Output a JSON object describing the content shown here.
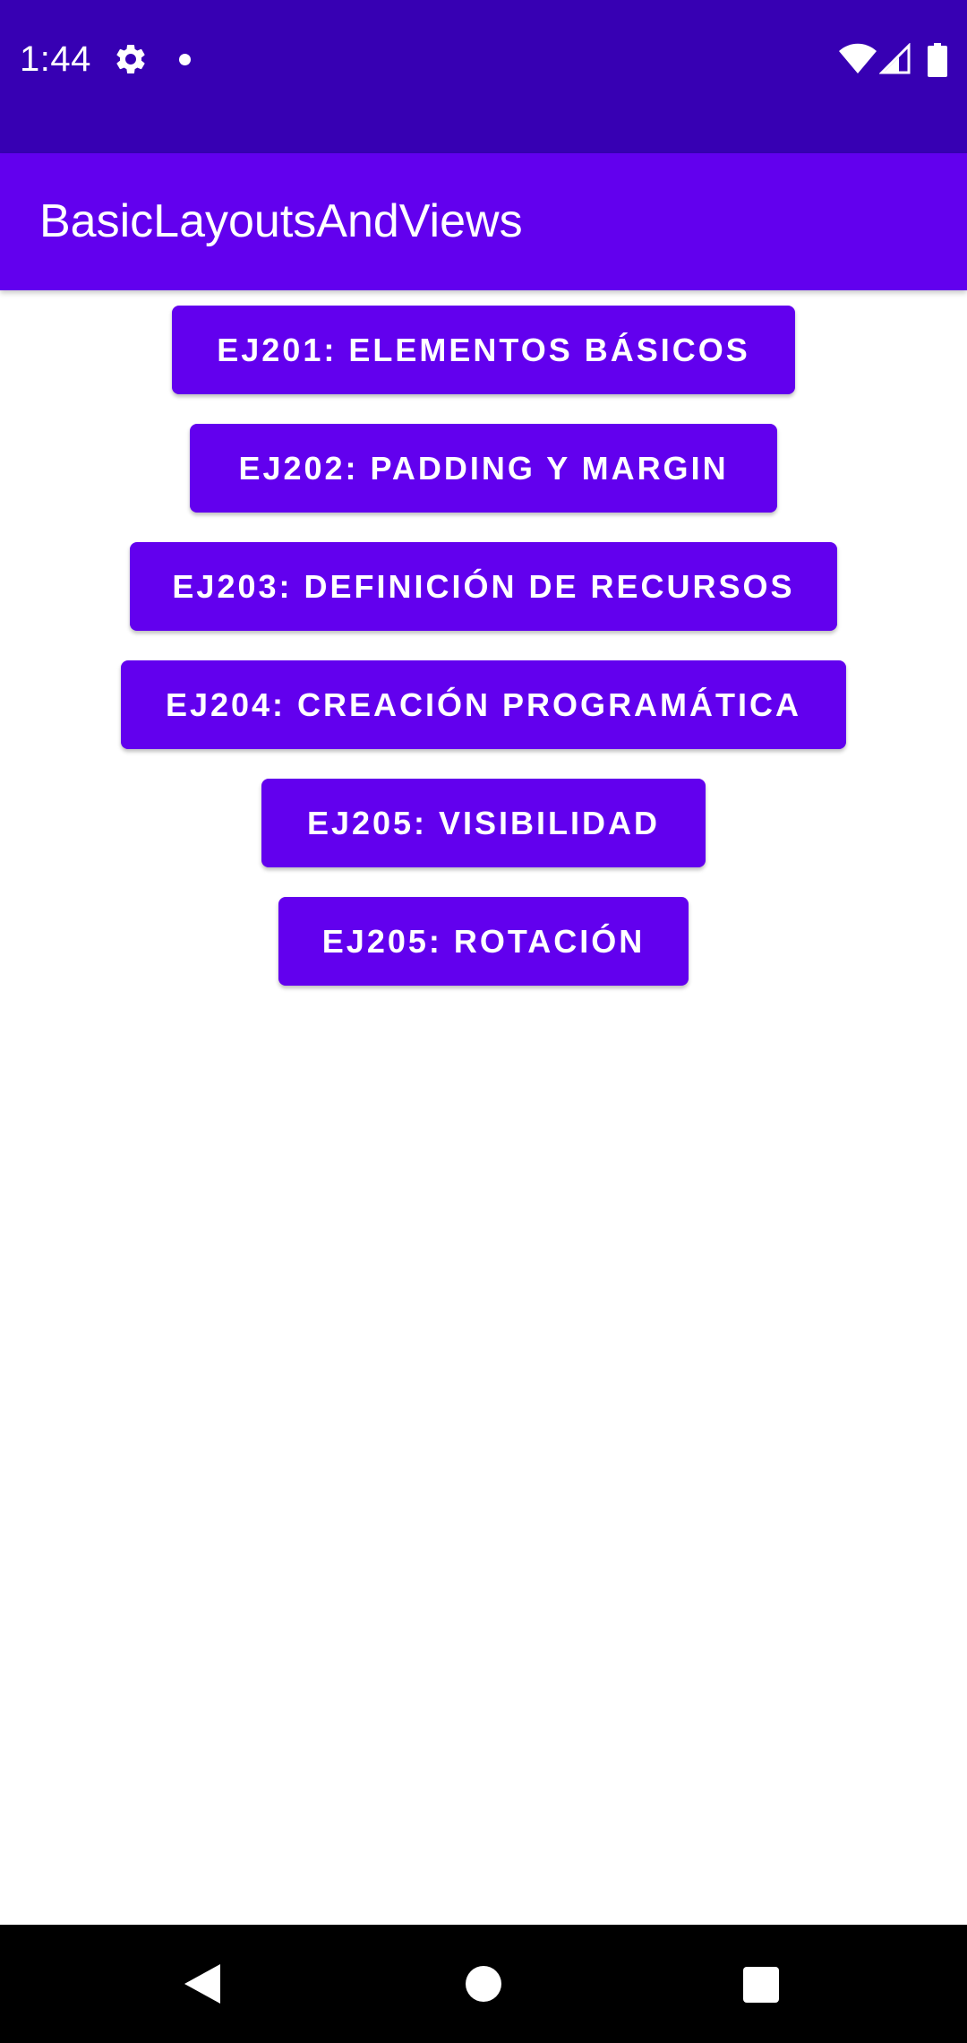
{
  "status_bar": {
    "time": "1:44",
    "background": "#3700b3",
    "icons": [
      "gear-icon",
      "notification-dot-icon",
      "wifi-icon",
      "signal-icon",
      "battery-icon"
    ]
  },
  "app_bar": {
    "title": "BasicLayoutsAndViews",
    "background": "#6200ee"
  },
  "buttons": [
    {
      "label": "EJ201: ELEMENTOS BÁSICOS"
    },
    {
      "label": "EJ202: PADDING Y MARGIN"
    },
    {
      "label": "EJ203: DEFINICIÓN DE RECURSOS"
    },
    {
      "label": "EJ204: CREACIÓN PROGRAMÁTICA"
    },
    {
      "label": "EJ205: VISIBILIDAD"
    },
    {
      "label": "EJ205: ROTACIÓN"
    }
  ],
  "colors": {
    "primary": "#6200ee",
    "primary_dark": "#3700b3",
    "on_primary": "#ffffff",
    "nav_bar": "#000000"
  },
  "nav_bar": {
    "icons": [
      "back-icon",
      "home-icon",
      "recents-icon"
    ]
  }
}
